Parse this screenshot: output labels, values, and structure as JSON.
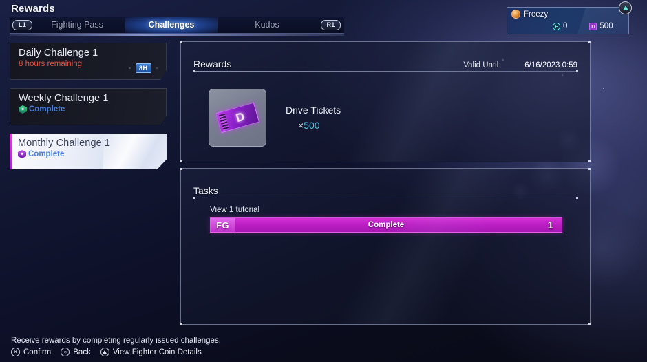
{
  "header": {
    "page_title": "Rewards",
    "left_shoulder": "L1",
    "right_shoulder": "R1",
    "tabs": [
      {
        "label": "Fighting Pass",
        "selected": false
      },
      {
        "label": "Challenges",
        "selected": true
      },
      {
        "label": "Kudos",
        "selected": false
      }
    ]
  },
  "player": {
    "name": "Freezy",
    "avatar_icon": "player-avatar-icon",
    "fighter_coin_icon": "fighter-coin-icon",
    "fighter_coins": "0",
    "drive_ticket_icon": "drive-ticket-icon",
    "drive_tickets": "500",
    "triangle_button_icon": "triangle-button-icon"
  },
  "sidebar": {
    "cards": [
      {
        "title": "Daily Challenge 1",
        "status": "8 hours remaining",
        "status_type": "timer",
        "badge": "8H",
        "badge_icon": "time-remaining-badge",
        "selected": false
      },
      {
        "title": "Weekly Challenge 1",
        "status": "Complete",
        "status_type": "complete",
        "rank_icon": "weekly-hex-badge-icon",
        "selected": false
      },
      {
        "title": "Monthly Challenge 1",
        "status": "Complete",
        "status_type": "complete",
        "rank_icon": "monthly-hex-badge-icon",
        "selected": true
      }
    ]
  },
  "rewards_panel": {
    "title": "Rewards",
    "valid_until_label": "Valid Until",
    "valid_until_value": "6/16/2023 0:59",
    "item": {
      "icon": "drive-ticket-item-icon",
      "icon_letter": "D",
      "name": "Drive Tickets",
      "quantity_prefix": "×",
      "quantity": "500"
    }
  },
  "tasks_panel": {
    "title": "Tasks",
    "tasks": [
      {
        "label": "View 1 tutorial",
        "badge": "FG",
        "status": "Complete",
        "count": "1",
        "progress_percent": 100
      }
    ]
  },
  "footer": {
    "description": "Receive rewards by completing regularly issued challenges.",
    "prompts": [
      {
        "glyph": "✕",
        "icon": "cross-button-icon",
        "label": "Confirm"
      },
      {
        "glyph": "○",
        "icon": "circle-button-icon",
        "label": "Back"
      },
      {
        "glyph": "△",
        "icon": "triangle-button-icon",
        "label": "View Fighter Coin Details"
      }
    ]
  },
  "colors": {
    "accent_magenta": "#c42bd0",
    "accent_cyan": "#4fc8e8",
    "accent_blue": "#4a7fe0",
    "warning_red": "#e8503c"
  }
}
